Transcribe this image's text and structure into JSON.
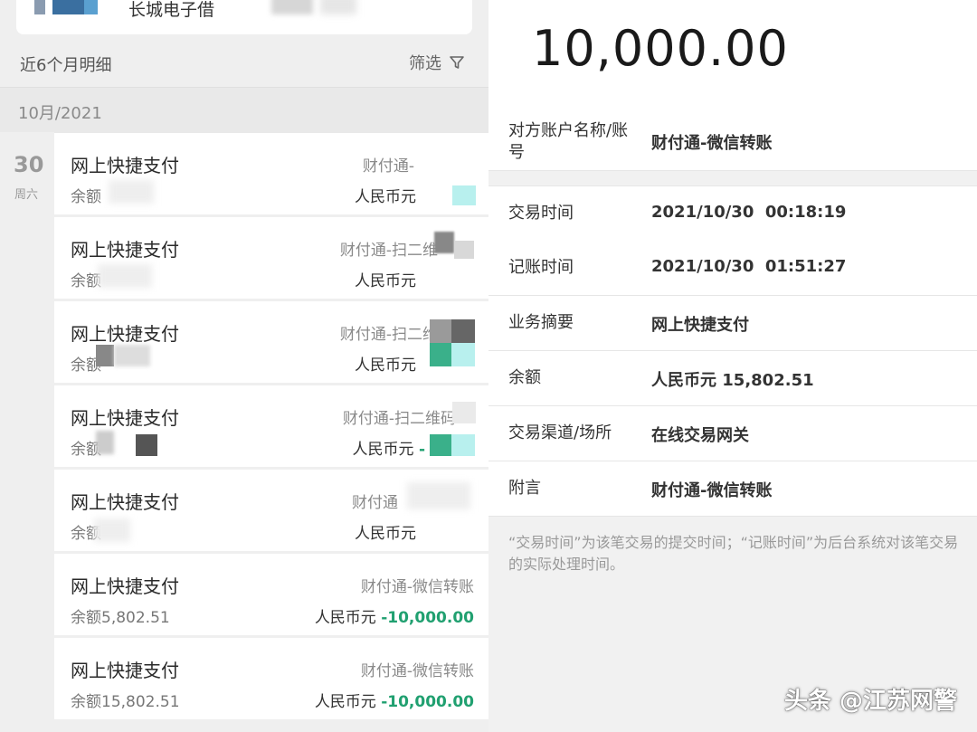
{
  "left": {
    "bank_name": "长城电子借",
    "summary_label": "近6个月明细",
    "filter_label": "筛选",
    "month_label": "10月/2021",
    "day": {
      "num": "30",
      "week": "周六"
    },
    "transactions": [
      {
        "title": "网上快捷支付",
        "balance": "余额",
        "party": "财付通-",
        "currency": "人民币元",
        "amount": ""
      },
      {
        "title": "网上快捷支付",
        "balance": "余额",
        "party": "财付通-扫二维",
        "currency": "人民币元",
        "amount": ""
      },
      {
        "title": "网上快捷支付",
        "balance": "余额",
        "party": "财付通-扫二维",
        "currency": "人民币元",
        "amount": ""
      },
      {
        "title": "网上快捷支付",
        "balance": "余额",
        "party": "财付通-扫二维码",
        "currency": "人民币元",
        "amount": "-"
      },
      {
        "title": "网上快捷支付",
        "balance": "余额",
        "party": "财付通",
        "currency": "人民币元",
        "amount": ""
      },
      {
        "title": "网上快捷支付",
        "balance": "余额5,802.51",
        "party": "财付通-微信转账",
        "currency": "人民币元",
        "amount": "-10,000.00"
      },
      {
        "title": "网上快捷支付",
        "balance": "余额15,802.51",
        "party": "财付通-微信转账",
        "currency": "人民币元",
        "amount": "-10,000.00"
      }
    ]
  },
  "right": {
    "amount": "10,000.00",
    "rows": [
      {
        "key": "对方账户名称/账号",
        "value": "财付通-微信转账"
      },
      {
        "key": "交易时间",
        "value": "2021/10/30  00:18:19"
      },
      {
        "key": "记账时间",
        "value": "2021/10/30  01:51:27"
      },
      {
        "key": "业务摘要",
        "value": "网上快捷支付"
      },
      {
        "key": "余额",
        "value": "人民币元 15,802.51"
      },
      {
        "key": "交易渠道/场所",
        "value": "在线交易网关"
      },
      {
        "key": "附言",
        "value": "财付通-微信转账"
      }
    ],
    "note": "“交易时间”为该笔交易的提交时间；“记账时间”为后台系统对该笔交易的实际处理时间。"
  },
  "watermark": "头条 @江苏网警",
  "colors": {
    "negative_amount": "#20a070",
    "mosaic_teal": "#3ab08a",
    "mosaic_cyan": "#b8f0ee"
  }
}
